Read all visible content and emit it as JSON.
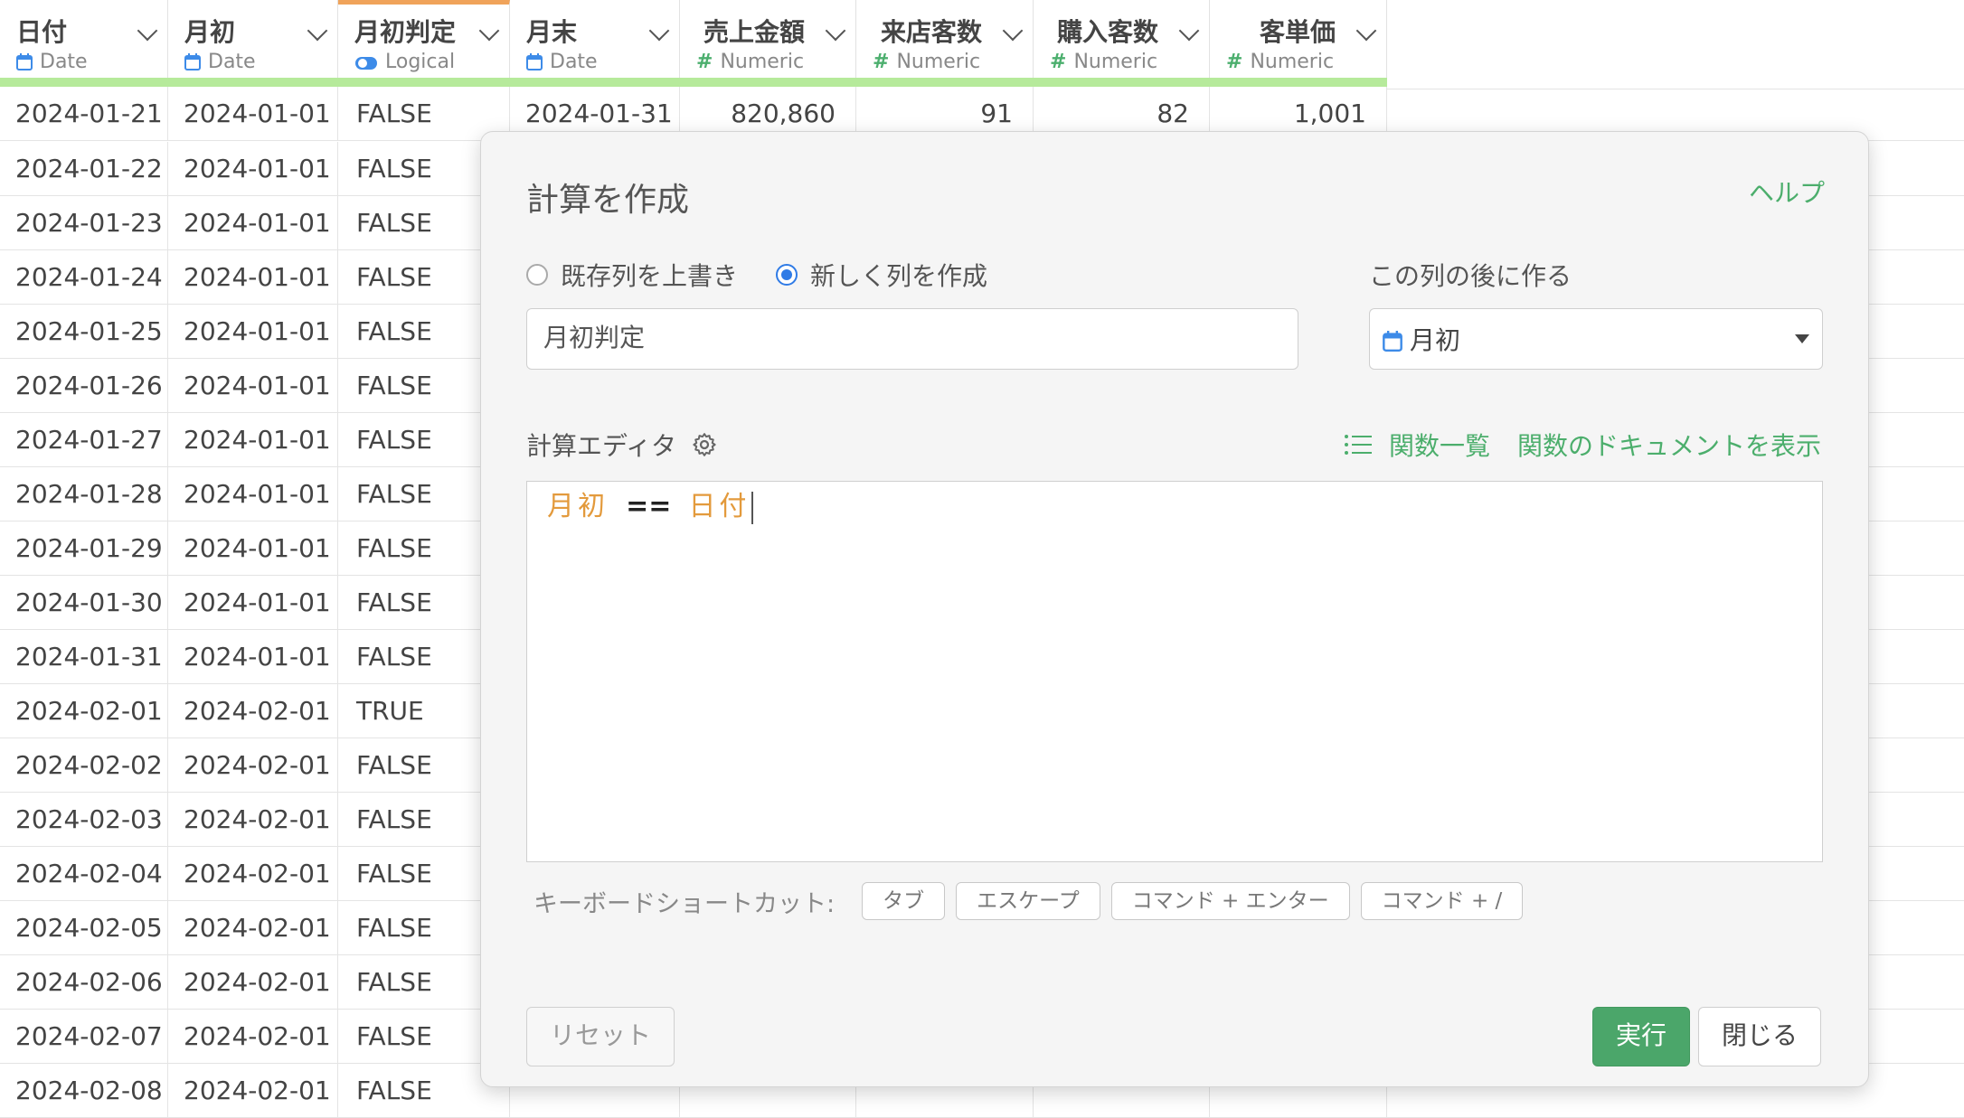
{
  "grid": {
    "columns": [
      {
        "name": "日付",
        "type": "Date",
        "type_icon": "calendar-icon"
      },
      {
        "name": "月初",
        "type": "Date",
        "type_icon": "calendar-icon"
      },
      {
        "name": "月初判定",
        "type": "Logical",
        "type_icon": "toggle-icon"
      },
      {
        "name": "月末",
        "type": "Date",
        "type_icon": "calendar-icon"
      },
      {
        "name": "売上金額",
        "type": "Numeric",
        "type_icon": "hash-icon"
      },
      {
        "name": "来店客数",
        "type": "Numeric",
        "type_icon": "hash-icon"
      },
      {
        "name": "購入客数",
        "type": "Numeric",
        "type_icon": "hash-icon"
      },
      {
        "name": "客単価",
        "type": "Numeric",
        "type_icon": "hash-icon"
      }
    ],
    "first_row": [
      "2024-01-21",
      "2024-01-01",
      "FALSE",
      "2024-01-31",
      "820,860",
      "91",
      "82",
      "1,001"
    ],
    "rows": [
      [
        "2024-01-22",
        "2024-01-01",
        "FALSE"
      ],
      [
        "2024-01-23",
        "2024-01-01",
        "FALSE"
      ],
      [
        "2024-01-24",
        "2024-01-01",
        "FALSE"
      ],
      [
        "2024-01-25",
        "2024-01-01",
        "FALSE"
      ],
      [
        "2024-01-26",
        "2024-01-01",
        "FALSE"
      ],
      [
        "2024-01-27",
        "2024-01-01",
        "FALSE"
      ],
      [
        "2024-01-28",
        "2024-01-01",
        "FALSE"
      ],
      [
        "2024-01-29",
        "2024-01-01",
        "FALSE"
      ],
      [
        "2024-01-30",
        "2024-01-01",
        "FALSE"
      ],
      [
        "2024-01-31",
        "2024-01-01",
        "FALSE"
      ],
      [
        "2024-02-01",
        "2024-02-01",
        "TRUE"
      ],
      [
        "2024-02-02",
        "2024-02-01",
        "FALSE"
      ],
      [
        "2024-02-03",
        "2024-02-01",
        "FALSE"
      ],
      [
        "2024-02-04",
        "2024-02-01",
        "FALSE"
      ],
      [
        "2024-02-05",
        "2024-02-01",
        "FALSE"
      ],
      [
        "2024-02-06",
        "2024-02-01",
        "FALSE"
      ],
      [
        "2024-02-07",
        "2024-02-01",
        "FALSE"
      ],
      [
        "2024-02-08",
        "2024-02-01",
        "FALSE"
      ]
    ],
    "colors": {
      "header_accent": "#f0a35a",
      "header_bar": "#b6ea9b",
      "numeric_icon": "#4caf6e",
      "date_icon": "#3d8be8"
    }
  },
  "dialog": {
    "title": "計算を作成",
    "help": "ヘルプ",
    "radio_overwrite": "既存列を上書き",
    "radio_new": "新しく列を作成",
    "selected_mode": "new",
    "after_label": "この列の後に作る",
    "column_name_value": "月初判定",
    "after_column_value": "月初",
    "editor_label": "計算エディタ",
    "func_list": "関数一覧",
    "func_docs": "関数のドキュメントを表示",
    "expression": {
      "lhs": "月初",
      "op": "==",
      "rhs": "日付"
    },
    "shortcut_label": "キーボードショートカット:",
    "shortcuts": [
      "タブ",
      "エスケープ",
      "コマンド + エンター",
      "コマンド + /"
    ],
    "reset": "リセット",
    "run": "実行",
    "close": "閉じる",
    "colors": {
      "accent_green": "#4ba66a",
      "token_orange": "#e39a3c",
      "radio_blue": "#2f7be6"
    }
  }
}
